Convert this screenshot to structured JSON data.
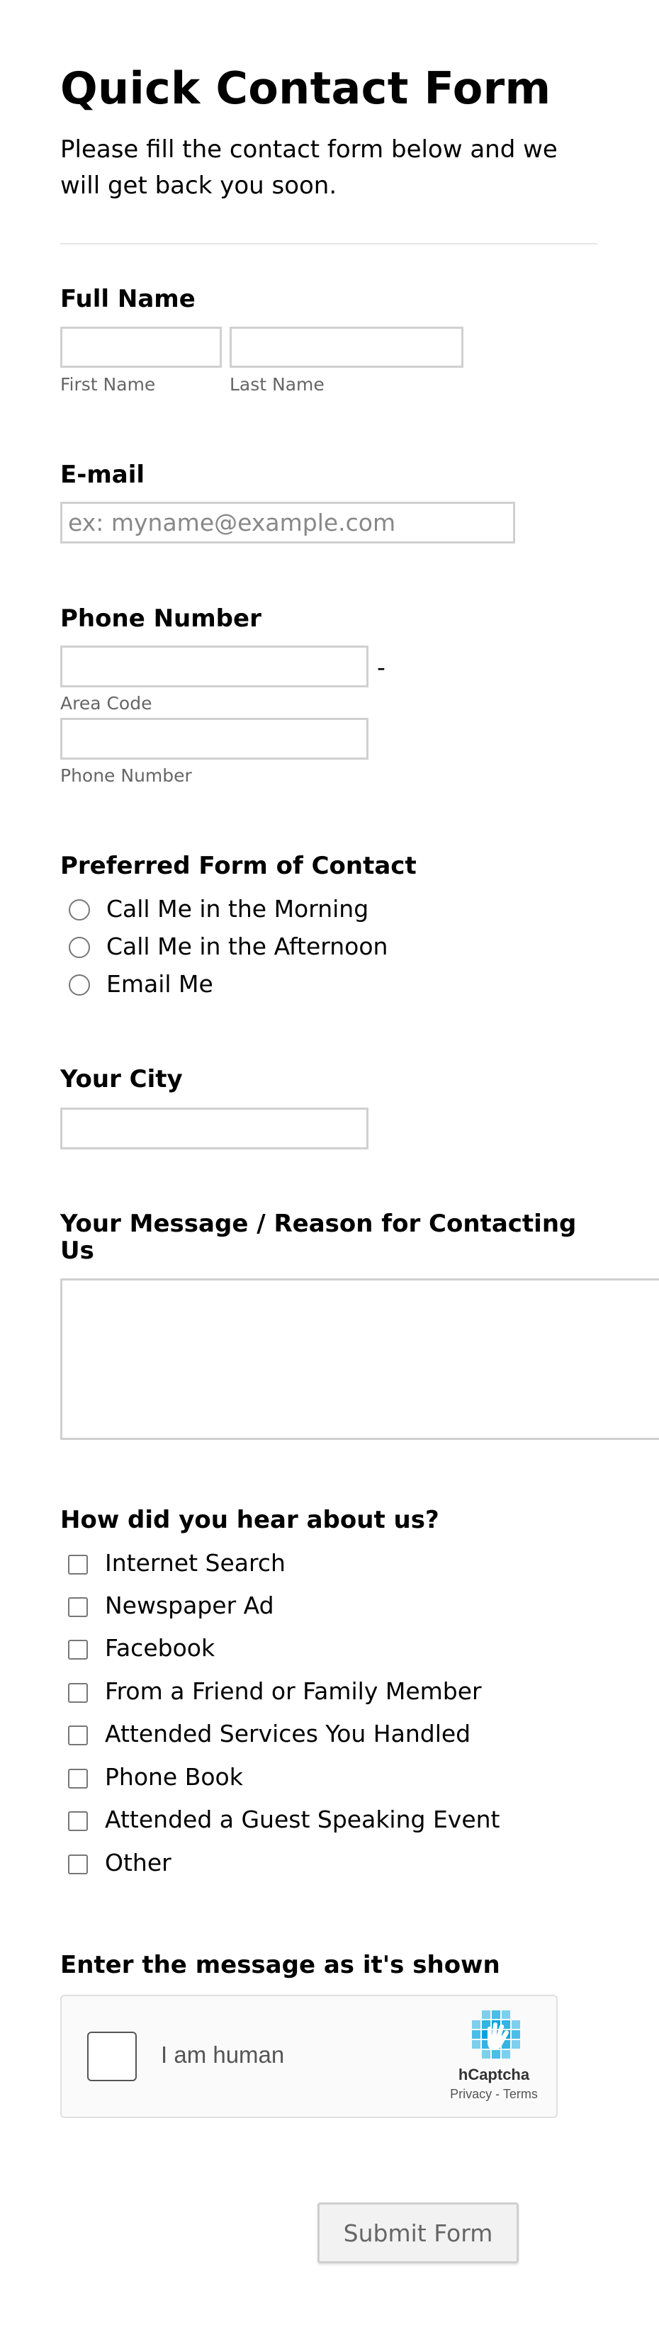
{
  "form": {
    "title": "Quick Contact Form",
    "subtitle": "Please fill the contact form below and we will get back you soon."
  },
  "full_name": {
    "label": "Full Name",
    "first_sublabel": "First Name",
    "last_sublabel": "Last Name",
    "first_value": "",
    "last_value": ""
  },
  "email": {
    "label": "E-mail",
    "placeholder": "ex: myname@example.com",
    "value": ""
  },
  "phone": {
    "label": "Phone Number",
    "separator": "-",
    "area_sublabel": "Area Code",
    "number_sublabel": "Phone Number",
    "area_value": "",
    "number_value": ""
  },
  "contact_pref": {
    "label": "Preferred Form of Contact",
    "options": [
      {
        "label": "Call Me in the Morning",
        "selected": false
      },
      {
        "label": "Call Me in the Afternoon",
        "selected": false
      },
      {
        "label": "Email Me",
        "selected": false
      }
    ]
  },
  "city": {
    "label": "Your City",
    "value": ""
  },
  "message": {
    "label": "Your Message / Reason for Contacting Us",
    "value": ""
  },
  "referral": {
    "label": "How did you hear about us?",
    "options": [
      {
        "label": "Internet Search",
        "checked": false
      },
      {
        "label": "Newspaper Ad",
        "checked": false
      },
      {
        "label": "Facebook",
        "checked": false
      },
      {
        "label": "From a Friend or Family Member",
        "checked": false
      },
      {
        "label": "Attended Services You Handled",
        "checked": false
      },
      {
        "label": "Phone Book",
        "checked": false
      },
      {
        "label": "Attended a Guest Speaking Event",
        "checked": false
      },
      {
        "label": "Other",
        "checked": false
      }
    ]
  },
  "captcha": {
    "label": "Enter the message as it's shown",
    "checkbox_text": "I am human",
    "brand": "hCaptcha",
    "links": "Privacy - Terms",
    "brand_color": "#0074bf",
    "accent_color": "#00a3e0"
  },
  "submit": {
    "label": "Submit Form"
  }
}
